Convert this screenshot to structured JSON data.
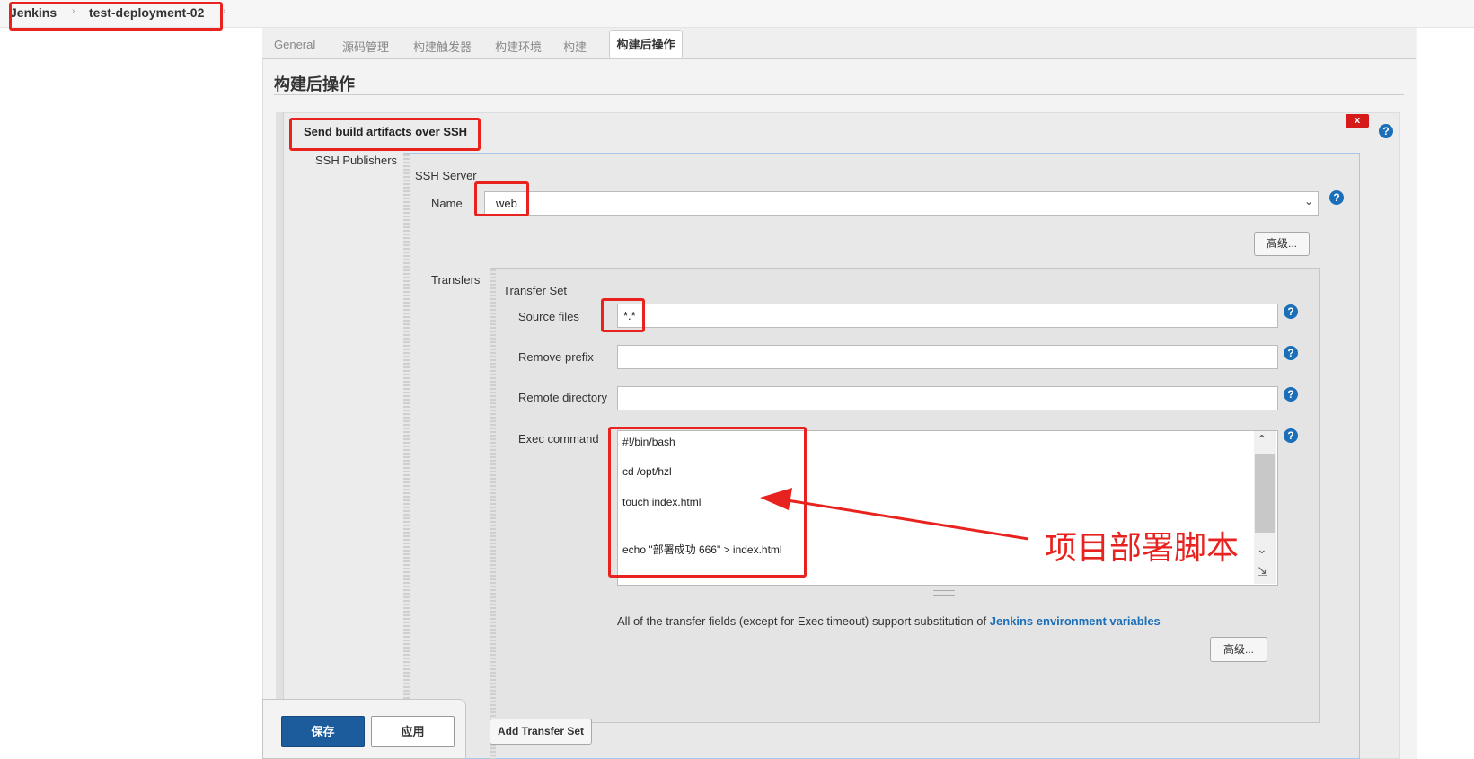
{
  "breadcrumb": {
    "root": "Jenkins",
    "project": "test-deployment-02",
    "separator": "›"
  },
  "tabs": [
    {
      "label": "General"
    },
    {
      "label": "源码管理"
    },
    {
      "label": "构建触发器"
    },
    {
      "label": "构建环境"
    },
    {
      "label": "构建"
    },
    {
      "label": "构建后操作"
    }
  ],
  "section": {
    "title": "构建后操作",
    "ssh_block_title": "Send build artifacts over SSH",
    "close_label": "x",
    "help_glyph": "?"
  },
  "publishers": {
    "label": "SSH Publishers",
    "server_label": "SSH Server",
    "name_label": "Name",
    "name_value": "web",
    "advanced_label": "高级..."
  },
  "transfers": {
    "label": "Transfers",
    "set_label": "Transfer Set",
    "source_files_label": "Source files",
    "source_files_value": "*.*",
    "remove_prefix_label": "Remove prefix",
    "remove_prefix_value": "",
    "remote_directory_label": "Remote directory",
    "remote_directory_value": "",
    "exec_command_label": "Exec command",
    "exec_lines": [
      "#!/bin/bash",
      "cd /opt/hzl",
      "touch index.html",
      "echo \"部署成功  666\" > index.html"
    ],
    "note_text": "All of the transfer fields (except for Exec timeout) support substitution of ",
    "note_link": "Jenkins environment variables",
    "advanced_label": "高级...",
    "add_transfer_set_label": "Add Transfer Set"
  },
  "annotation": {
    "text": "项目部署脚本",
    "color": "#e8231f"
  },
  "footer": {
    "save_label": "保存",
    "apply_label": "应用"
  },
  "colors": {
    "primary": "#1d5c9c",
    "highlight": "#e8231f",
    "help": "#1b6fb8"
  }
}
